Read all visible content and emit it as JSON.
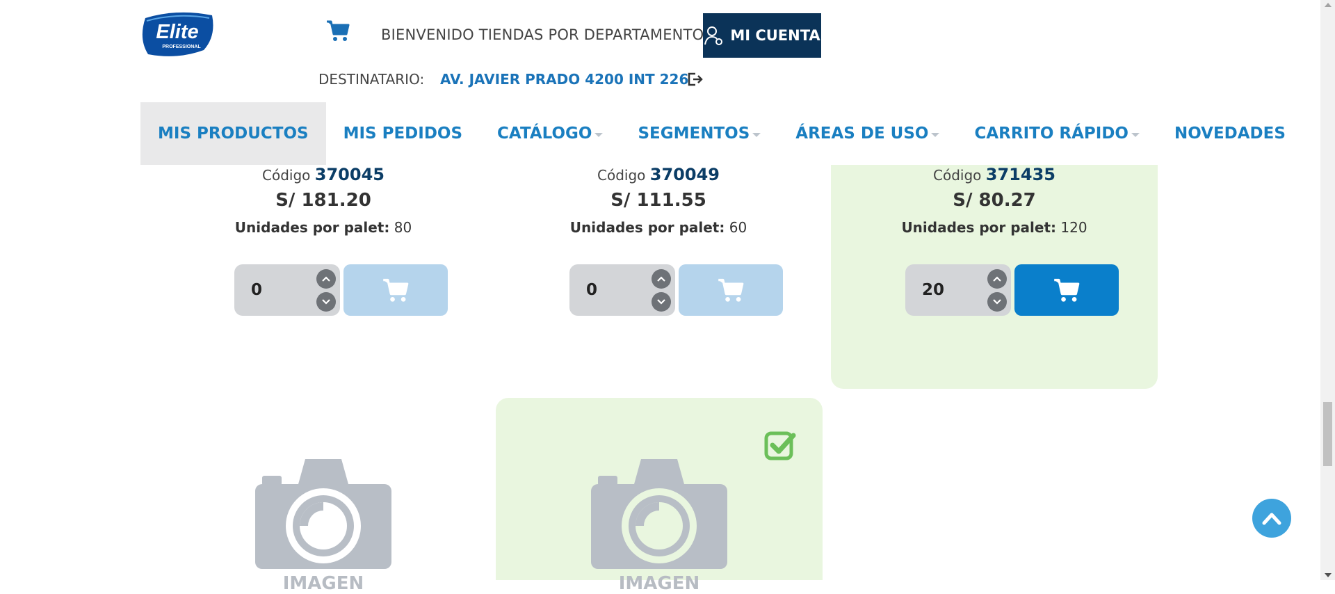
{
  "header": {
    "logo_text": "Elite",
    "logo_sub": "PROFESSIONAL",
    "welcome": "BIENVENIDO TIENDAS POR DEPARTAMENTO",
    "account_label": "MI CUENTA",
    "dest_label": "DESTINATARIO:",
    "dest_value": "AV. JAVIER PRADO 4200 INT 226"
  },
  "nav": {
    "items": [
      {
        "label": "MIS PRODUCTOS",
        "active": true
      },
      {
        "label": "MIS PEDIDOS"
      },
      {
        "label": "CATÁLOGO",
        "dropdown": true
      },
      {
        "label": "SEGMENTOS",
        "dropdown": true
      },
      {
        "label": "ÁREAS DE USO",
        "dropdown": true
      },
      {
        "label": "CARRITO RÁPIDO",
        "dropdown": true
      },
      {
        "label": "NOVEDADES"
      }
    ]
  },
  "products": [
    {
      "code_label": "Código",
      "code": "370045",
      "price": "S/ 181.20",
      "units_label": "Unidades por palet:",
      "units": "80",
      "qty": "0"
    },
    {
      "code_label": "Código",
      "code": "370049",
      "price": "S/ 111.55",
      "units_label": "Unidades por palet:",
      "units": "60",
      "qty": "0"
    },
    {
      "code_label": "Código",
      "code": "371435",
      "price": "S/ 80.27",
      "units_label": "Unidades por palet:",
      "units": "120",
      "qty": "20"
    }
  ],
  "image_cards": [
    {
      "placeholder": "IMAGEN"
    },
    {
      "placeholder": "IMAGEN"
    }
  ],
  "colors": {
    "brand_navy": "#0b3358",
    "link_blue": "#1a7fc1",
    "selected_bg": "#e9f6df",
    "cart_enabled": "#0a7fcb",
    "cart_disabled": "#b5d4ec",
    "check_green": "#6bbf59"
  }
}
